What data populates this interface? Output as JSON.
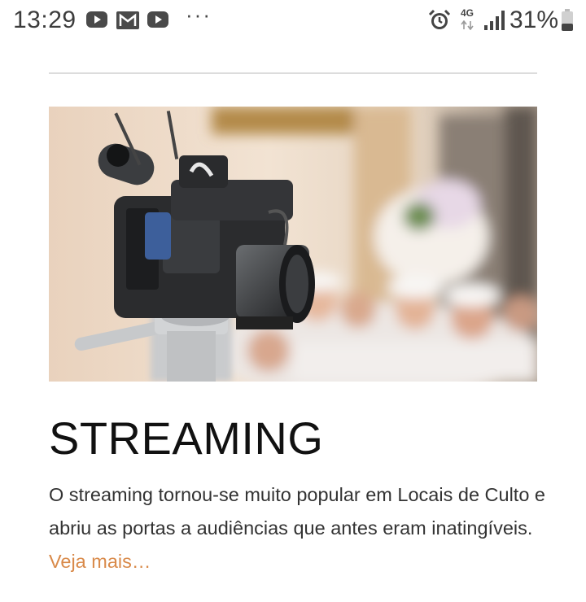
{
  "status_bar": {
    "time": "13:29",
    "notifications": [
      "youtube-icon",
      "mail-icon",
      "youtube-icon"
    ],
    "more_indicator": "···",
    "network_type": "4G",
    "battery_percent": "31%",
    "icons": [
      "alarm-icon",
      "data-arrows-icon",
      "signal-icon",
      "battery-icon"
    ]
  },
  "article": {
    "image_alt": "",
    "title": "STREAMING",
    "description": "O streaming tornou-se muito popular em Locais de Culto e abriu as portas a audiências que antes eram inatingíveis.",
    "more_link": "Veja mais…"
  },
  "colors": {
    "link": "#d98a4a",
    "title": "#111111",
    "text": "#333333",
    "divider": "#dcdcdc"
  }
}
